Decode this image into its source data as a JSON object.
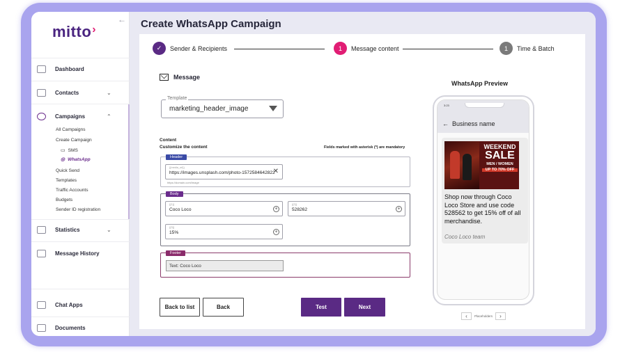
{
  "brand": {
    "logo_text": "mitto",
    "logo_mark": "›",
    "accent": "#5a2a84",
    "pink": "#e11d74"
  },
  "sidebar": {
    "collapse_icon": "←",
    "items": [
      {
        "label": "Dashboard",
        "icon": "dashboard-icon"
      },
      {
        "label": "Contacts",
        "icon": "contacts-icon",
        "caret": "⌄"
      },
      {
        "label": "Campaigns",
        "icon": "campaigns-icon",
        "caret": "⌃"
      },
      {
        "label": "Statistics",
        "icon": "statistics-icon",
        "caret": "⌄"
      },
      {
        "label": "Message History",
        "icon": "message-history-icon"
      },
      {
        "label": "Chat Apps",
        "icon": "chat-apps-icon"
      },
      {
        "label": "Documents",
        "icon": "documents-icon"
      }
    ],
    "campaign_sub": {
      "all": "All Campaigns",
      "create": "Create Campaign",
      "sms": "SMS",
      "whatsapp": "WhatsApp",
      "quick_send": "Quick Send",
      "templates": "Templates",
      "traffic_accounts": "Traffic Accounts",
      "budgets": "Budgets",
      "sender_id": "Sender ID registration"
    }
  },
  "page": {
    "title": "Create WhatsApp Campaign"
  },
  "stepper": {
    "steps": [
      {
        "label": "Sender & Recipients",
        "marker": "✓",
        "color": "#5a2a84"
      },
      {
        "label": "Message content",
        "marker": "1",
        "color": "#e11d74"
      },
      {
        "label": "Time & Batch",
        "marker": "1",
        "color": "#7a7a7a"
      }
    ]
  },
  "message": {
    "heading": "Message",
    "template_label": "Template",
    "template_value": "marketing_header_image",
    "content_label": "Content",
    "customize_label": "Customize the content",
    "mandatory_note": "Fields marked with asterisk (*) are mandatory",
    "header": {
      "pill": "Header",
      "field_label": "{{media_url}}",
      "value": "https://images.unsplash.com/photo-1572584642822",
      "hint": "https://domain.com/image"
    },
    "body": {
      "pill": "Body",
      "f1_label": "{{1}}",
      "f1_value": "Coco Loco",
      "f2_label": "{{2}}",
      "f2_value": "528262",
      "f3_label": "{{3}}",
      "f3_value": "15%"
    },
    "footer": {
      "pill": "Footer",
      "value": "Text: Coco Loco"
    }
  },
  "buttons": {
    "back_to_list": "Back to list",
    "back": "Back",
    "test": "Test",
    "next": "Next"
  },
  "preview": {
    "title": "WhatsApp Preview",
    "time": "3:23",
    "business": "Business name",
    "back_arrow": "←",
    "ad": {
      "line1": "WEEKEND",
      "line2": "SALE",
      "line3": "MEN / WOMEN",
      "line4": "UP TO 70% OFF"
    },
    "message": "Shop now through Coco Loco Store and use code 528562 to get 15% off of all merchandise.",
    "signature": "Coco Loco team",
    "pager_label": "Placeholders",
    "prev": "‹",
    "next": "›"
  }
}
